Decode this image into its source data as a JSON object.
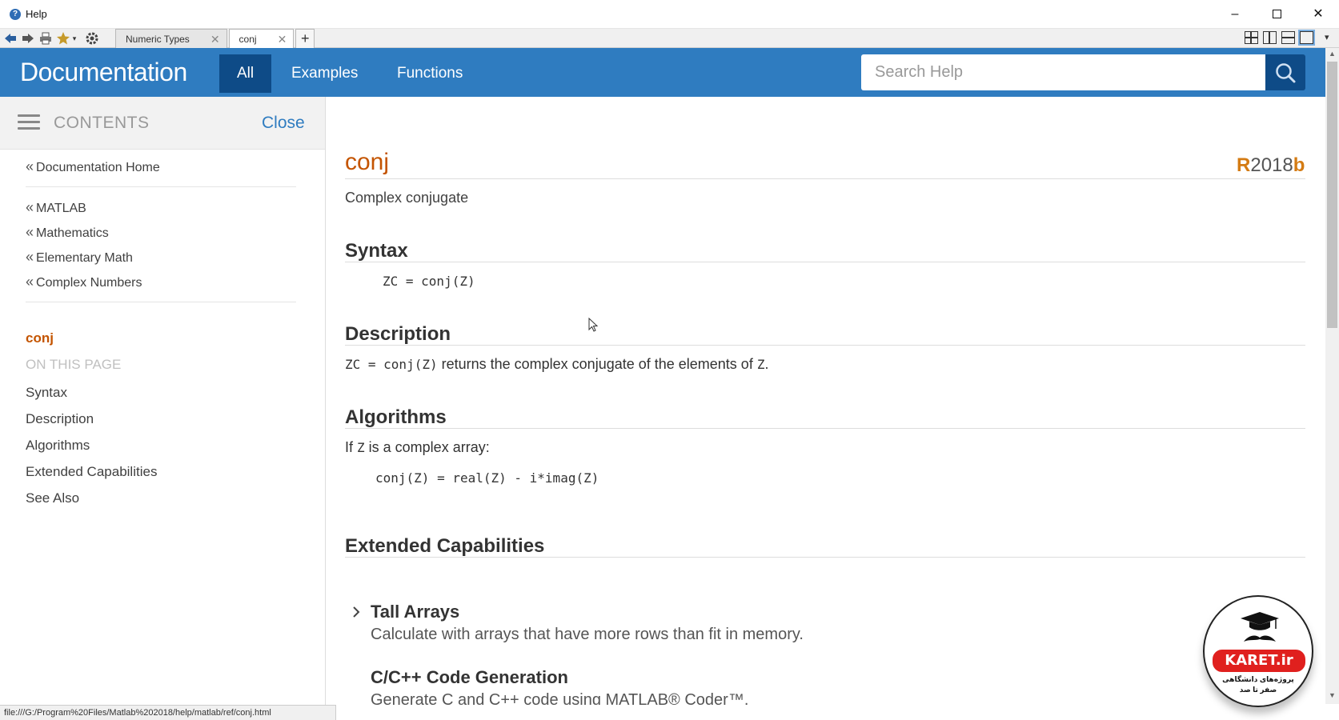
{
  "window": {
    "title": "Help",
    "min_glyph": "–",
    "close_glyph": "✕"
  },
  "browser_tabs": [
    {
      "label": "Numeric Types",
      "close": "✕"
    },
    {
      "label": "conj",
      "close": "✕"
    }
  ],
  "new_tab_label": "+",
  "header": {
    "title": "Documentation",
    "tabs": [
      "All",
      "Examples",
      "Functions"
    ],
    "search_placeholder": "Search Help"
  },
  "sidebar": {
    "contents_label": "CONTENTS",
    "close_label": "Close",
    "breadcrumbs": [
      "Documentation Home",
      "MATLAB",
      "Mathematics",
      "Elementary Math",
      "Complex Numbers"
    ],
    "breadcrumb_marker": "«",
    "current_page": "conj",
    "on_this_page_label": "ON THIS PAGE",
    "on_this_page": [
      "Syntax",
      "Description",
      "Algorithms",
      "Extended Capabilities",
      "See Also"
    ]
  },
  "page": {
    "title": "conj",
    "release": {
      "prefix": "R",
      "year": "2018",
      "suffix": "b"
    },
    "subtitle": "Complex conjugate",
    "syntax_heading": "Syntax",
    "syntax_code": "ZC = conj(Z)",
    "description_heading": "Description",
    "description_code": "ZC = conj(Z)",
    "description_text": " returns the complex conjugate of the elements of ",
    "description_var": "Z",
    "description_end": ".",
    "algorithms_heading": "Algorithms",
    "algorithms_text_pre": "If ",
    "algorithms_var": "Z",
    "algorithms_text_post": " is a complex array:",
    "algorithms_code": "conj(Z) = real(Z) - i*imag(Z)",
    "extended_heading": "Extended Capabilities",
    "capabilities": [
      {
        "title": "Tall Arrays",
        "desc": "Calculate with arrays that have more rows than fit in memory."
      },
      {
        "title": "C/C++ Code Generation",
        "desc": "Generate C and C++ code using MATLAB® Coder™."
      }
    ]
  },
  "statusbar": {
    "url": "file:///G:/Program%20Files/Matlab%202018/help/matlab/ref/conj.html"
  },
  "watermark": {
    "brand": "KARET.ir",
    "line1": "پروژه‌های دانشگاهی",
    "line2": "صفر تا صد"
  },
  "colors": {
    "header_blue": "#2f7cc0",
    "header_dark": "#0e4b87",
    "title_orange": "#c45400",
    "release_orange": "#d47b13"
  },
  "icons": {
    "back": "back-arrow-icon",
    "forward": "forward-arrow-icon",
    "print": "print-icon",
    "favorite": "favorites-star-icon",
    "settings": "gear-icon",
    "search": "search-icon",
    "menu": "hamburger-menu-icon",
    "expand": "chevron-right-icon"
  }
}
